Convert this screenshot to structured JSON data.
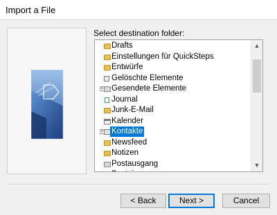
{
  "window": {
    "title": "Import a File"
  },
  "main": {
    "folder_label": "Select destination folder:"
  },
  "folders": [
    {
      "label": "Drafts",
      "icon": "drafts-folder-icon",
      "kind": "yellow",
      "expandable": false,
      "selected": false
    },
    {
      "label": "Einstellungen für QuickSteps",
      "icon": "folder-icon",
      "kind": "yellow",
      "expandable": false,
      "selected": false
    },
    {
      "label": "Entwürfe",
      "icon": "folder-icon",
      "kind": "yellow",
      "expandable": false,
      "selected": false
    },
    {
      "label": "Gelöschte Elemente",
      "icon": "deleted-items-icon",
      "kind": "trash",
      "expandable": false,
      "selected": false
    },
    {
      "label": "Gesendete Elemente",
      "icon": "folder-icon",
      "kind": "gray",
      "expandable": true,
      "selected": false
    },
    {
      "label": "Journal",
      "icon": "journal-icon",
      "kind": "journal",
      "expandable": false,
      "selected": false
    },
    {
      "label": "Junk-E-Mail",
      "icon": "folder-icon",
      "kind": "yellow",
      "expandable": false,
      "selected": false
    },
    {
      "label": "Kalender",
      "icon": "calendar-icon",
      "kind": "cal",
      "expandable": false,
      "selected": false
    },
    {
      "label": "Kontakte",
      "icon": "contacts-icon",
      "kind": "contact",
      "expandable": true,
      "selected": true
    },
    {
      "label": "Newsfeed",
      "icon": "folder-icon",
      "kind": "yellow",
      "expandable": false,
      "selected": false
    },
    {
      "label": "Notizen",
      "icon": "notes-icon",
      "kind": "yellow",
      "expandable": false,
      "selected": false
    },
    {
      "label": "Postausgang",
      "icon": "outbox-icon",
      "kind": "gray",
      "expandable": false,
      "selected": false
    },
    {
      "label": "Posteingang",
      "icon": "inbox-icon",
      "kind": "gray",
      "expandable": true,
      "selected": false
    }
  ],
  "buttons": {
    "back": "< Back",
    "next": "Next >",
    "cancel": "Cancel"
  },
  "colors": {
    "selection": "#0078d7",
    "default_button_border": "#0078d7",
    "folder_yellow": "#e8c04a"
  }
}
